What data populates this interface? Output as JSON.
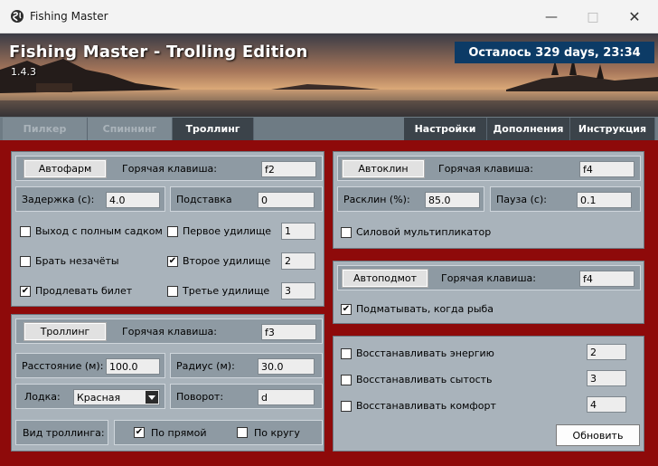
{
  "window": {
    "title": "Fishing Master"
  },
  "banner": {
    "title": "Fishing Master - Trolling Edition",
    "version": "1.4.3",
    "countdown": "Осталось 329 days, 23:34"
  },
  "tabs_left": [
    {
      "label": "Пилкер",
      "active": false
    },
    {
      "label": "Спиннинг",
      "active": false
    },
    {
      "label": "Троллинг",
      "active": true
    }
  ],
  "tabs_right": [
    {
      "label": "Настройки"
    },
    {
      "label": "Дополнения"
    },
    {
      "label": "Инструкция"
    }
  ],
  "autofarm": {
    "button": "Автофарм",
    "hotkey_label": "Горячая клавиша:",
    "hotkey_value": "f2",
    "delay_label": "Задержка (с):",
    "delay_value": "4.0",
    "stand_label": "Подставка",
    "stand_value": "0",
    "exit_full_label": "Выход с полным садком",
    "exit_full_checked": false,
    "take_miss_label": "Брать незачёты",
    "take_miss_checked": false,
    "extend_ticket_label": "Продлевать билет",
    "extend_ticket_checked": true,
    "rod1_label": "Первое удилище",
    "rod1_checked": false,
    "rod1_value": "1",
    "rod2_label": "Второе удилище",
    "rod2_checked": true,
    "rod2_value": "2",
    "rod3_label": "Третье удилище",
    "rod3_checked": false,
    "rod3_value": "3"
  },
  "trolling": {
    "button": "Троллинг",
    "hotkey_label": "Горячая клавиша:",
    "hotkey_value": "f3",
    "distance_label": "Расстояние (м):",
    "distance_value": "100.0",
    "radius_label": "Радиус (м):",
    "radius_value": "30.0",
    "boat_label": "Лодка:",
    "boat_value": "Красная",
    "turn_label": "Поворот:",
    "turn_value": "d",
    "type_label": "Вид троллинга:",
    "straight_label": "По прямой",
    "straight_checked": true,
    "circle_label": "По кругу",
    "circle_checked": false
  },
  "autoclean": {
    "button": "Автоклин",
    "hotkey_label": "Горячая клавиша:",
    "hotkey_value": "f4",
    "ratio_label": "Расклин (%):",
    "ratio_value": "85.0",
    "pause_label": "Пауза (с):",
    "pause_value": "0.1",
    "multiplier_label": "Силовой мультипликатор",
    "multiplier_checked": false
  },
  "autoreel": {
    "button": "Автоподмот",
    "hotkey_label": "Горячая клавиша:",
    "hotkey_value": "f4",
    "reel_fish_label": "Подматывать, когда рыба",
    "reel_fish_checked": true
  },
  "restore": {
    "energy_label": "Восстанавливать энергию",
    "energy_checked": false,
    "energy_value": "2",
    "satiety_label": "Восстанавливать сытость",
    "satiety_checked": false,
    "satiety_value": "3",
    "comfort_label": "Восстанавливать комфорт",
    "comfort_checked": false,
    "comfort_value": "4",
    "update_button": "Обновить"
  }
}
